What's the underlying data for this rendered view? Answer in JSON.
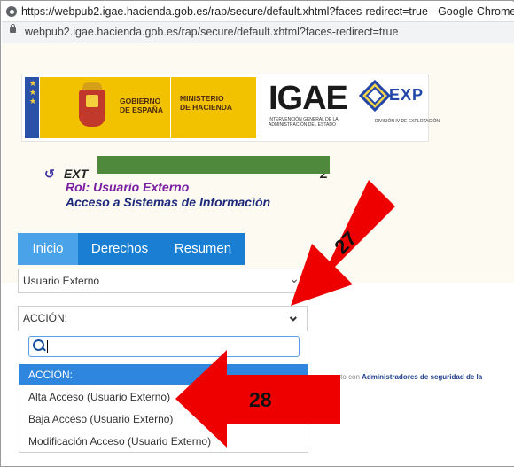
{
  "browser": {
    "window_title": "https://webpub2.igae.hacienda.gob.es/rap/secure/default.xhtml?faces-redirect=true - Google Chrome",
    "url": "webpub2.igae.hacienda.gob.es/rap/secure/default.xhtml?faces-redirect=true"
  },
  "logos": {
    "gobierno": [
      "GOBIERNO",
      "DE ESPAÑA"
    ],
    "ministerio": [
      "MINISTERIO",
      "DE HACIENDA"
    ],
    "igae": "IGAE",
    "igae_sub": "INTERVENCIÓN GENERAL DE LA ADMINISTRACIÓN DEL ESTADO",
    "dexp": "EXP",
    "dexp_sub": "DIVISIÓN IV DE EXPLOTACIÓN"
  },
  "user": {
    "name_prefix": "EXT",
    "name_suffix": "Z",
    "role": "Rol: Usuario Externo",
    "access": "Acceso a Sistemas de Información"
  },
  "tabs": [
    {
      "label": "Inicio",
      "active": true
    },
    {
      "label": "Derechos",
      "active": false
    },
    {
      "label": "Resumen",
      "active": false
    }
  ],
  "user_type_select": {
    "value": "Usuario Externo"
  },
  "action_select": {
    "value": "ACCIÓN:"
  },
  "dropdown": {
    "search_value": "",
    "options": [
      {
        "label": "ACCIÓN:",
        "highlighted": true
      },
      {
        "label": "Alta Acceso (Usuario Externo)",
        "highlighted": false
      },
      {
        "label": "Baja Acceso (Usuario Externo)",
        "highlighted": false
      },
      {
        "label": "Modificación Acceso (Usuario Externo)",
        "highlighted": false
      }
    ]
  },
  "contact_text": {
    "prefix": "ntacto con ",
    "link": "Administradores de seguridad de la"
  },
  "annotations": {
    "step_a": "27",
    "step_b": "28",
    "arrow_color": "#ee0000"
  }
}
